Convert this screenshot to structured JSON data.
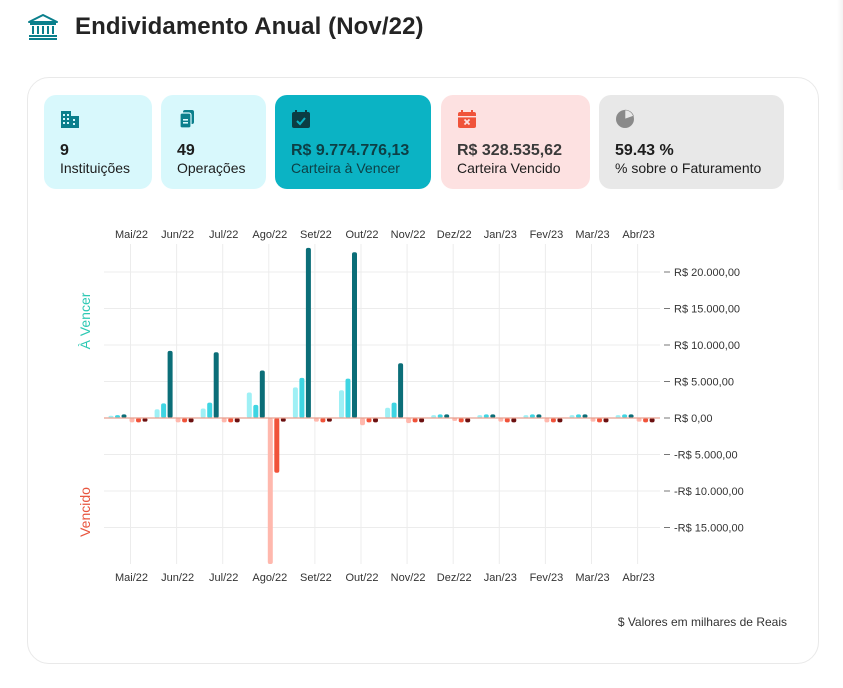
{
  "header": {
    "title": "Endividamento Anual (Nov/22)",
    "icon": "bank-icon"
  },
  "cards": [
    {
      "value": "9",
      "label": "Instituições",
      "icon": "building-icon",
      "color": "#d8f8fc"
    },
    {
      "value": "49",
      "label": "Operações",
      "icon": "documents-icon",
      "color": "#d8f8fc"
    },
    {
      "value": "R$ 9.774.776,13",
      "label": "Carteira à Vencer",
      "icon": "calendar-check-icon",
      "color": "#0bb3c4"
    },
    {
      "value": "R$ 328.535,62",
      "label": "Carteira Vencido",
      "icon": "calendar-x-icon",
      "color": "#fde1e1"
    },
    {
      "value": "59.43 %",
      "label": "% sobre o Faturamento",
      "icon": "pie-chart-icon",
      "color": "#e8e8e8"
    }
  ],
  "footnote": "$ Valores em milhares de Reais",
  "chart_data": {
    "type": "bar",
    "categories": [
      "Mai/22",
      "Jun/22",
      "Jul/22",
      "Ago/22",
      "Set/22",
      "Out/22",
      "Nov/22",
      "Dez/22",
      "Jan/23",
      "Fev/23",
      "Mar/23",
      "Abr/23"
    ],
    "upper_label": "À Vencer",
    "lower_label": "Vencido",
    "y_ticks": [
      {
        "value": 20000,
        "label": "R$ 20.000,00"
      },
      {
        "value": 15000,
        "label": "R$ 15.000,00"
      },
      {
        "value": 10000,
        "label": "R$ 10.000,00"
      },
      {
        "value": 5000,
        "label": "R$ 5.000,00"
      },
      {
        "value": 0,
        "label": "R$ 0,00"
      },
      {
        "value": -5000,
        "label": "-R$ 5.000,00"
      },
      {
        "value": -10000,
        "label": "-R$ 10.000,00"
      },
      {
        "value": -15000,
        "label": "-R$ 15.000,00"
      }
    ],
    "ylim": [
      -20000,
      24000
    ],
    "series": [
      {
        "group": "a_vencer",
        "color": "#9ff0f5",
        "values": [
          300,
          1200,
          1300,
          3500,
          4200,
          3800,
          1400,
          400,
          400,
          400,
          400,
          400
        ]
      },
      {
        "group": "a_vencer",
        "color": "#3fd5e2",
        "values": [
          400,
          2000,
          2100,
          1800,
          5500,
          5400,
          2100,
          500,
          500,
          500,
          500,
          500
        ]
      },
      {
        "group": "a_vencer",
        "color": "#0b6e78",
        "values": [
          500,
          9200,
          9000,
          6500,
          23300,
          22700,
          7500,
          500,
          500,
          500,
          500,
          500
        ]
      },
      {
        "group": "vencido",
        "color": "#ffb8ad",
        "values": [
          -600,
          -600,
          -600,
          -20000,
          -500,
          -1000,
          -700,
          -400,
          -500,
          -600,
          -500,
          -500
        ]
      },
      {
        "group": "vencido",
        "color": "#f0533a",
        "values": [
          -600,
          -600,
          -600,
          -7500,
          -600,
          -600,
          -600,
          -600,
          -600,
          -600,
          -600,
          -600
        ]
      },
      {
        "group": "vencido",
        "color": "#6b1010",
        "values": [
          -500,
          -600,
          -600,
          -500,
          -500,
          -600,
          -600,
          -600,
          -600,
          -600,
          -600,
          -600
        ]
      }
    ],
    "colors": {
      "upper_label": "#2ec9b4",
      "lower_label": "#e8563f"
    },
    "grid": true
  }
}
